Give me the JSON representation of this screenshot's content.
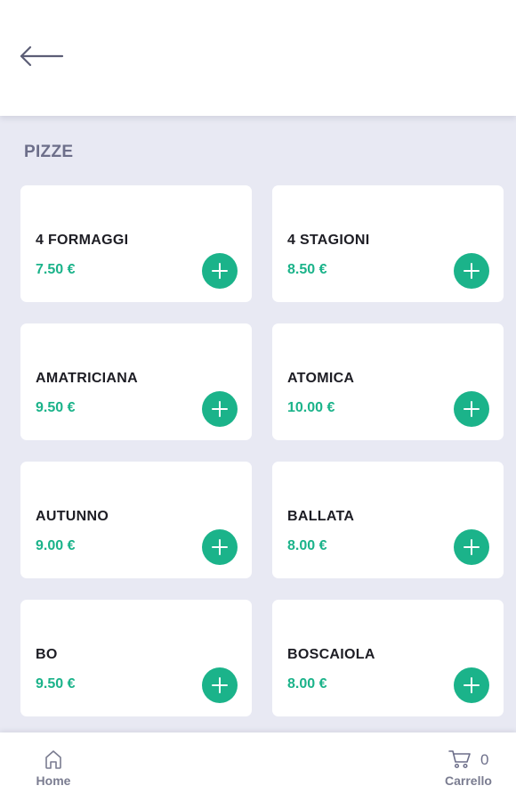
{
  "header": {
    "back_icon": "arrow-left-icon"
  },
  "section": {
    "title": "PIZZE"
  },
  "products": [
    {
      "name": "4 FORMAGGI",
      "price": "7.50 €"
    },
    {
      "name": "4 STAGIONI",
      "price": "8.50 €"
    },
    {
      "name": "AMATRICIANA",
      "price": "9.50 €"
    },
    {
      "name": "ATOMICA",
      "price": "10.00 €"
    },
    {
      "name": "AUTUNNO",
      "price": "9.00 €"
    },
    {
      "name": "BALLATA",
      "price": "8.00 €"
    },
    {
      "name": "BO",
      "price": "9.50 €"
    },
    {
      "name": "BOSCAIOLA",
      "price": "8.00 €"
    }
  ],
  "bottom_nav": {
    "home_label": "Home",
    "home_icon": "home-icon",
    "cart_label": "Carrello",
    "cart_icon": "cart-icon",
    "cart_count": "0"
  },
  "colors": {
    "accent": "#1bb38a",
    "background": "#e8e9f3",
    "section_title": "#6d6f8a"
  }
}
